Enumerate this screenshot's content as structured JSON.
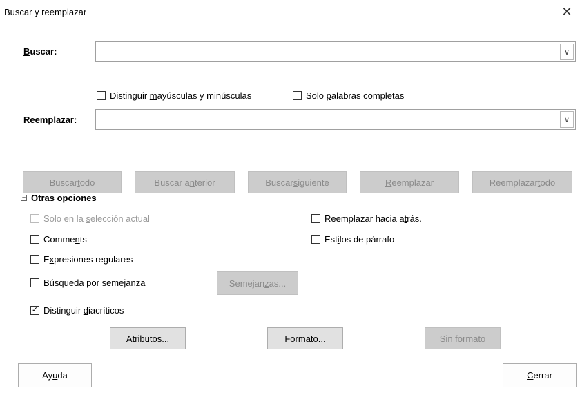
{
  "dialog": {
    "title": "Buscar y reemplazar",
    "close_glyph": "✕"
  },
  "search": {
    "label_u": "B",
    "label_rest": "uscar:",
    "value": ""
  },
  "search_options": {
    "match_case_pre": "Distinguir ",
    "match_case_u": "m",
    "match_case_post": "ayúsculas y minúsculas",
    "match_case_checked": false,
    "whole_words_pre": "Solo ",
    "whole_words_u": "p",
    "whole_words_post": "alabras completas",
    "whole_words_checked": false
  },
  "replace": {
    "label_u": "R",
    "label_rest": "eemplazar:",
    "value": ""
  },
  "action_buttons": {
    "find_all_pre": "Buscar ",
    "find_all_u": "t",
    "find_all_post": "odo",
    "find_prev_pre": "Buscar a",
    "find_prev_u": "n",
    "find_prev_post": "terior",
    "find_next_pre": "Buscar ",
    "find_next_u": "s",
    "find_next_post": "iguiente",
    "replace_u": "R",
    "replace_post": "eemplazar",
    "replace_all_pre": "Reemplazar ",
    "replace_all_u": "t",
    "replace_all_post": "odo"
  },
  "other_options": {
    "expander_glyph": "−",
    "header_u": "O",
    "header_rest": "tras opciones",
    "current_selection_pre": "Solo en la ",
    "current_selection_u": "s",
    "current_selection_post": "elección actual",
    "backwards_pre": "Reemplazar hacia a",
    "backwards_u": "t",
    "backwards_post": "rás.",
    "comments_pre": "Comme",
    "comments_u": "n",
    "comments_post": "ts",
    "paragraph_styles_pre": "Est",
    "paragraph_styles_u": "i",
    "paragraph_styles_post": "los de párrafo",
    "regex_pre": "E",
    "regex_u": "x",
    "regex_post": "presiones regulares",
    "similarity_pre": "Búsq",
    "similarity_u": "u",
    "similarity_post": "eda por semejanza",
    "similarities_btn_pre": "Semejan",
    "similarities_btn_u": "z",
    "similarities_btn_post": "as...",
    "diacritics_pre": "Distinguir ",
    "diacritics_u": "d",
    "diacritics_post": "iacríticos",
    "check_glyph": "✓",
    "attributes_pre": "A",
    "attributes_u": "t",
    "attributes_post": "ributos...",
    "format_pre": "For",
    "format_u": "m",
    "format_post": "ato...",
    "no_format_pre": "S",
    "no_format_u": "i",
    "no_format_post": "n formato"
  },
  "footer": {
    "help_pre": "Ay",
    "help_u": "u",
    "help_post": "da",
    "close_u": "C",
    "close_post": "errar"
  },
  "dropdown_glyph": "∨"
}
